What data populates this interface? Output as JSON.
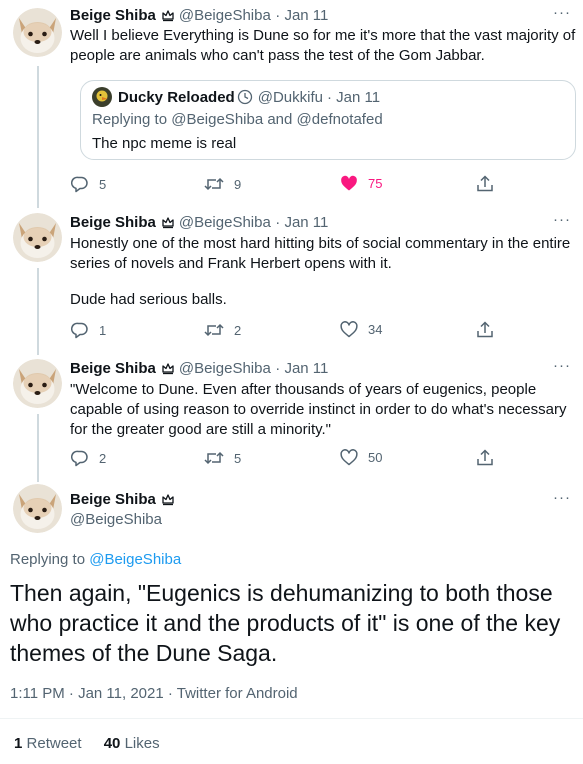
{
  "tweets": [
    {
      "name": "Beige Shiba",
      "handle": "@BeigeShiba",
      "date": "· Jan 11",
      "text": "Well I believe Everything is Dune so for me it's more that the vast majority of people are animals who can't pass the test of the Gom Jabbar.",
      "quote": {
        "name": "Ducky Reloaded",
        "handle": "@Dukkifu",
        "date": "· Jan 11",
        "replying_prefix": "Replying to",
        "replying_handles": "@BeigeShiba and @defnotafed",
        "text": "The npc meme is real"
      },
      "replies": "5",
      "retweets": "9",
      "likes": "75"
    },
    {
      "name": "Beige Shiba",
      "handle": "@BeigeShiba",
      "date": "· Jan 11",
      "text": "Honestly one of the most hard hitting bits of social commentary in the entire series of novels and Frank Herbert opens with it.",
      "text2": "Dude had serious balls.",
      "replies": "1",
      "retweets": "2",
      "likes": "34"
    },
    {
      "name": "Beige Shiba",
      "handle": "@BeigeShiba",
      "date": "· Jan 11",
      "text": "\"Welcome to Dune. Even after thousands of years of eugenics, people capable of using reason to override instinct in order to do what's necessary for the greater good are still a minority.\"",
      "replies": "2",
      "retweets": "5",
      "likes": "50"
    }
  ],
  "main": {
    "name": "Beige Shiba",
    "handle": "@BeigeShiba",
    "replying_prefix": "Replying to",
    "replying_handle": "@BeigeShiba",
    "text": "Then again, \"Eugenics is dehumanizing to both those who practice it and the products of it\" is one of the key themes of the Dune Saga.",
    "timestamp": "1:11 PM · Jan 11, 2021 · Twitter for Android",
    "retweet_count": "1",
    "retweet_label": "Retweet",
    "like_count": "40",
    "like_label": "Likes"
  },
  "more_label": "···",
  "colors": {
    "accent": "#1d9bf0",
    "like": "#f91880",
    "muted": "#536471"
  }
}
